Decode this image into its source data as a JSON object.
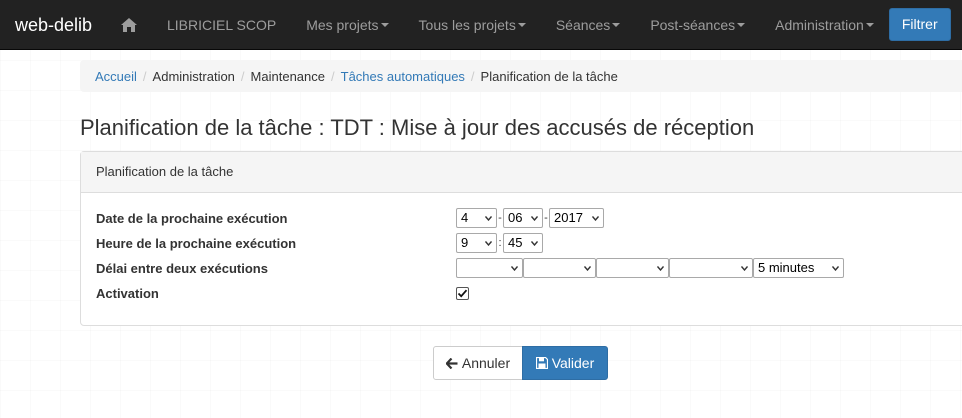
{
  "navbar": {
    "brand": "web-delib",
    "home_icon": "home-icon",
    "items": [
      {
        "label": "LIBRICIEL SCOP",
        "dropdown": false
      },
      {
        "label": "Mes projets",
        "dropdown": true
      },
      {
        "label": "Tous les projets",
        "dropdown": true
      },
      {
        "label": "Séances",
        "dropdown": true
      },
      {
        "label": "Post-séances",
        "dropdown": true
      },
      {
        "label": "Administration",
        "dropdown": true
      }
    ],
    "filter_button": "Filtrer",
    "colors": {
      "background": "#222222",
      "text": "#9d9d9d",
      "primary": "#337ab7"
    }
  },
  "breadcrumb": [
    {
      "label": "Accueil",
      "link": true
    },
    {
      "label": "Administration",
      "link": false
    },
    {
      "label": "Maintenance",
      "link": false
    },
    {
      "label": "Tâches automatiques",
      "link": true
    },
    {
      "label": "Planification de la tâche",
      "link": false
    }
  ],
  "page_title": "Planification de la tâche : TDT : Mise à jour des accusés de réception",
  "panel": {
    "heading": "Planification de la tâche",
    "fields": {
      "next_date": {
        "label": "Date de la prochaine exécution",
        "day": "4",
        "month": "06",
        "year": "2017"
      },
      "next_time": {
        "label": "Heure de la prochaine exécution",
        "hour": "9",
        "minute": "45"
      },
      "interval": {
        "label": "Délai entre deux exécutions",
        "values": [
          "",
          "",
          "",
          "",
          "5 minutes"
        ]
      },
      "activation": {
        "label": "Activation",
        "checked": true
      }
    }
  },
  "actions": {
    "cancel": "Annuler",
    "save": "Valider"
  }
}
